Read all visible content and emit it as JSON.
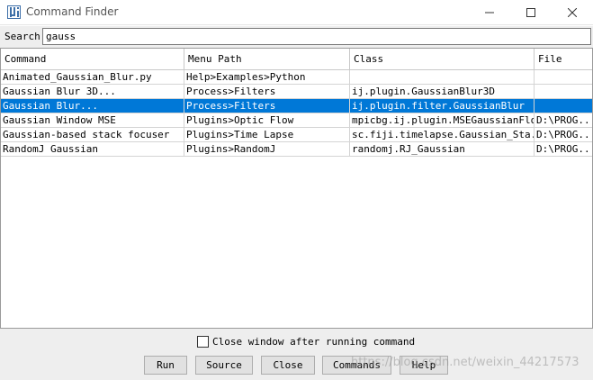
{
  "window": {
    "title": "Command Finder",
    "icon": "imagej-icon",
    "controls": [
      "minimize-icon",
      "maximize-icon",
      "close-icon"
    ]
  },
  "search": {
    "label": "Search:",
    "value": "gauss"
  },
  "table": {
    "columns": [
      "Command",
      "Menu Path",
      "Class",
      "File"
    ],
    "rows": [
      {
        "command": "Animated_Gaussian_Blur.py",
        "menu_path": "Help>Examples>Python",
        "class": "",
        "file": ""
      },
      {
        "command": "Gaussian Blur 3D...",
        "menu_path": "Process>Filters",
        "class": "ij.plugin.GaussianBlur3D",
        "file": ""
      },
      {
        "command": "Gaussian Blur...",
        "menu_path": "Process>Filters",
        "class": "ij.plugin.filter.GaussianBlur",
        "file": ""
      },
      {
        "command": "Gaussian Window MSE",
        "menu_path": "Plugins>Optic Flow",
        "class": "mpicbg.ij.plugin.MSEGaussianFlow",
        "file": "D:\\PROG..."
      },
      {
        "command": "Gaussian-based stack focuser",
        "menu_path": "Plugins>Time Lapse",
        "class": "sc.fiji.timelapse.Gaussian_Sta...",
        "file": "D:\\PROG..."
      },
      {
        "command": "RandomJ Gaussian",
        "menu_path": "Plugins>RandomJ",
        "class": "randomj.RJ_Gaussian",
        "file": "D:\\PROG..."
      }
    ],
    "selected_index": 2,
    "selection_color": "#0078d7"
  },
  "options": {
    "close_after_run_label": "Close window after running command",
    "close_after_run_checked": false
  },
  "buttons": {
    "run": "Run",
    "source": "Source",
    "close": "Close",
    "commands": "Commands",
    "help": "Help"
  },
  "watermark": "https://blog.csdn.net/weixin_44217573"
}
